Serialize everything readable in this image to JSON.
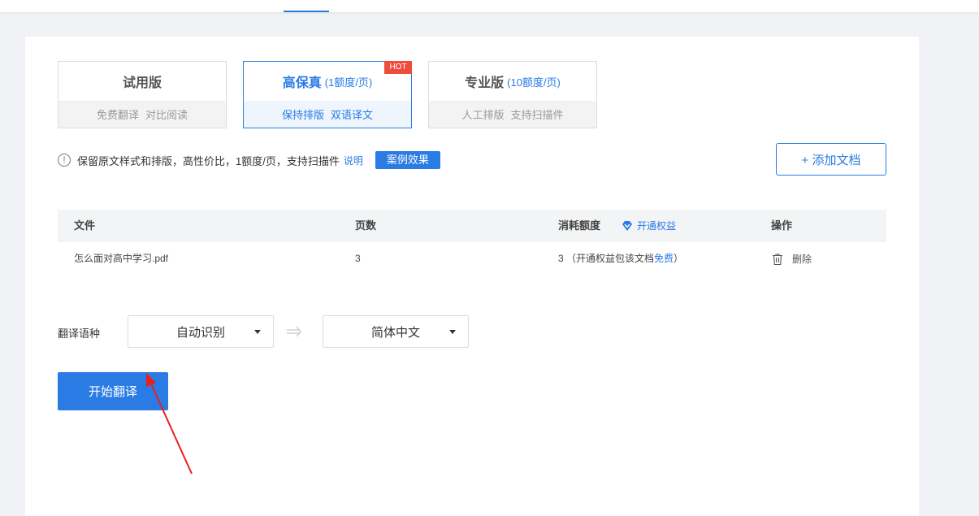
{
  "plans": [
    {
      "title": "试用版",
      "subtitle": "",
      "features": [
        "免费翻译",
        "对比阅读"
      ],
      "active": false
    },
    {
      "title": "高保真",
      "subtitle": "(1额度/页)",
      "features": [
        "保持排版",
        "双语译文"
      ],
      "active": true,
      "badge": "HOT"
    },
    {
      "title": "专业版",
      "subtitle": "(10额度/页)",
      "features": [
        "人工排版",
        "支持扫描件"
      ],
      "active": false
    }
  ],
  "info": {
    "text": "保留原文样式和排版，高性价比，1额度/页，支持扫描件",
    "link": "说明",
    "case_button": "案例效果"
  },
  "add_doc_label": "+ 添加文档",
  "table": {
    "headers": {
      "file": "文件",
      "pages": "页数",
      "cost": "消耗额度",
      "ops": "操作"
    },
    "perk_label": "开通权益",
    "rows": [
      {
        "file": "怎么面对高中学习.pdf",
        "pages": "3",
        "cost_prefix": "3 （开通权益包该文档",
        "cost_free": "免费",
        "cost_suffix": "）",
        "delete": "删除"
      }
    ]
  },
  "language": {
    "label": "翻译语种",
    "source": "自动识别",
    "target": "简体中文"
  },
  "start_button": "开始翻译",
  "colors": {
    "accent": "#2a7be4",
    "hot": "#ee4d3d",
    "annotation_arrow": "#e8201c"
  },
  "icons": [
    "info-icon",
    "diamond-icon",
    "trash-icon",
    "swap-arrow-icon",
    "caret-down-icon"
  ]
}
